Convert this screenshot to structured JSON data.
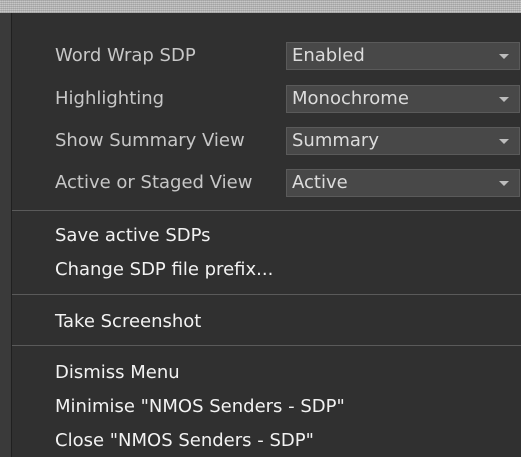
{
  "options": [
    {
      "label": "Word Wrap SDP",
      "value": "Enabled"
    },
    {
      "label": "Highlighting",
      "value": "Monochrome"
    },
    {
      "label": "Show Summary View",
      "value": "Summary"
    },
    {
      "label": "Active or Staged View",
      "value": "Active"
    }
  ],
  "actions": {
    "save_active": "Save active SDPs",
    "change_prefix": "Change SDP file prefix...",
    "screenshot": "Take Screenshot",
    "dismiss": "Dismiss Menu",
    "minimise": "Minimise \"NMOS Senders - SDP\"",
    "close": "Close \"NMOS Senders - SDP\""
  },
  "icons": {
    "dropdown": "chevron-down-icon"
  }
}
